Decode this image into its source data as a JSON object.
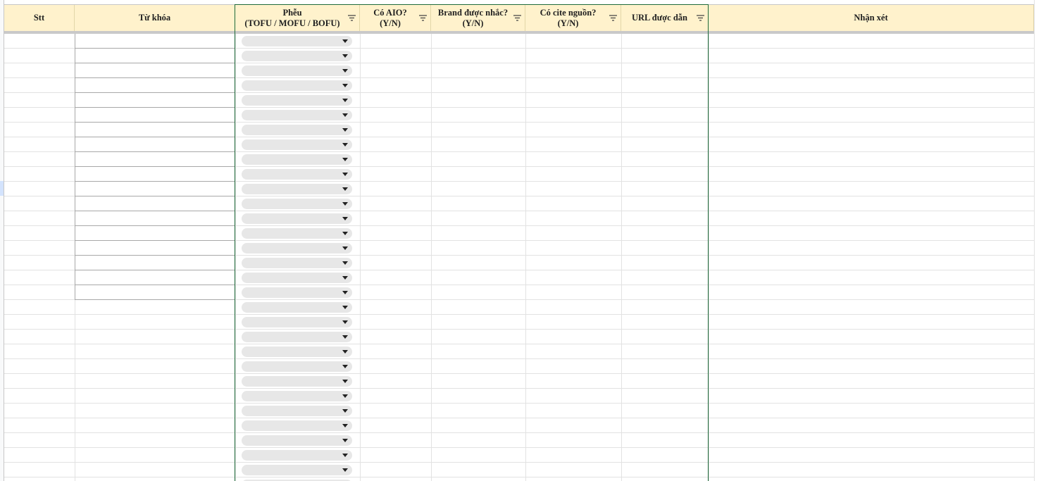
{
  "headers": {
    "stt": "Stt",
    "tu_khoa": "Từ khóa",
    "pheu": "Phễu\n(TOFU / MOFU / BOFU)",
    "co_aio": "Có AIO?\n(Y/N)",
    "brand": "Brand được nhắc?\n(Y/N)",
    "cite": "Có cite nguồn?\n(Y/N)",
    "url": "URL được dẫn",
    "nhan_xet": "Nhận xét"
  },
  "colors": {
    "header_bg": "#fff2cc",
    "selection_border": "#1e6b3a",
    "dropdown_chip": "#e7e7e7",
    "gridline": "#e2e2e2"
  },
  "icons": {
    "filter": "filter-icon",
    "dropdown": "dropdown-caret-icon"
  }
}
